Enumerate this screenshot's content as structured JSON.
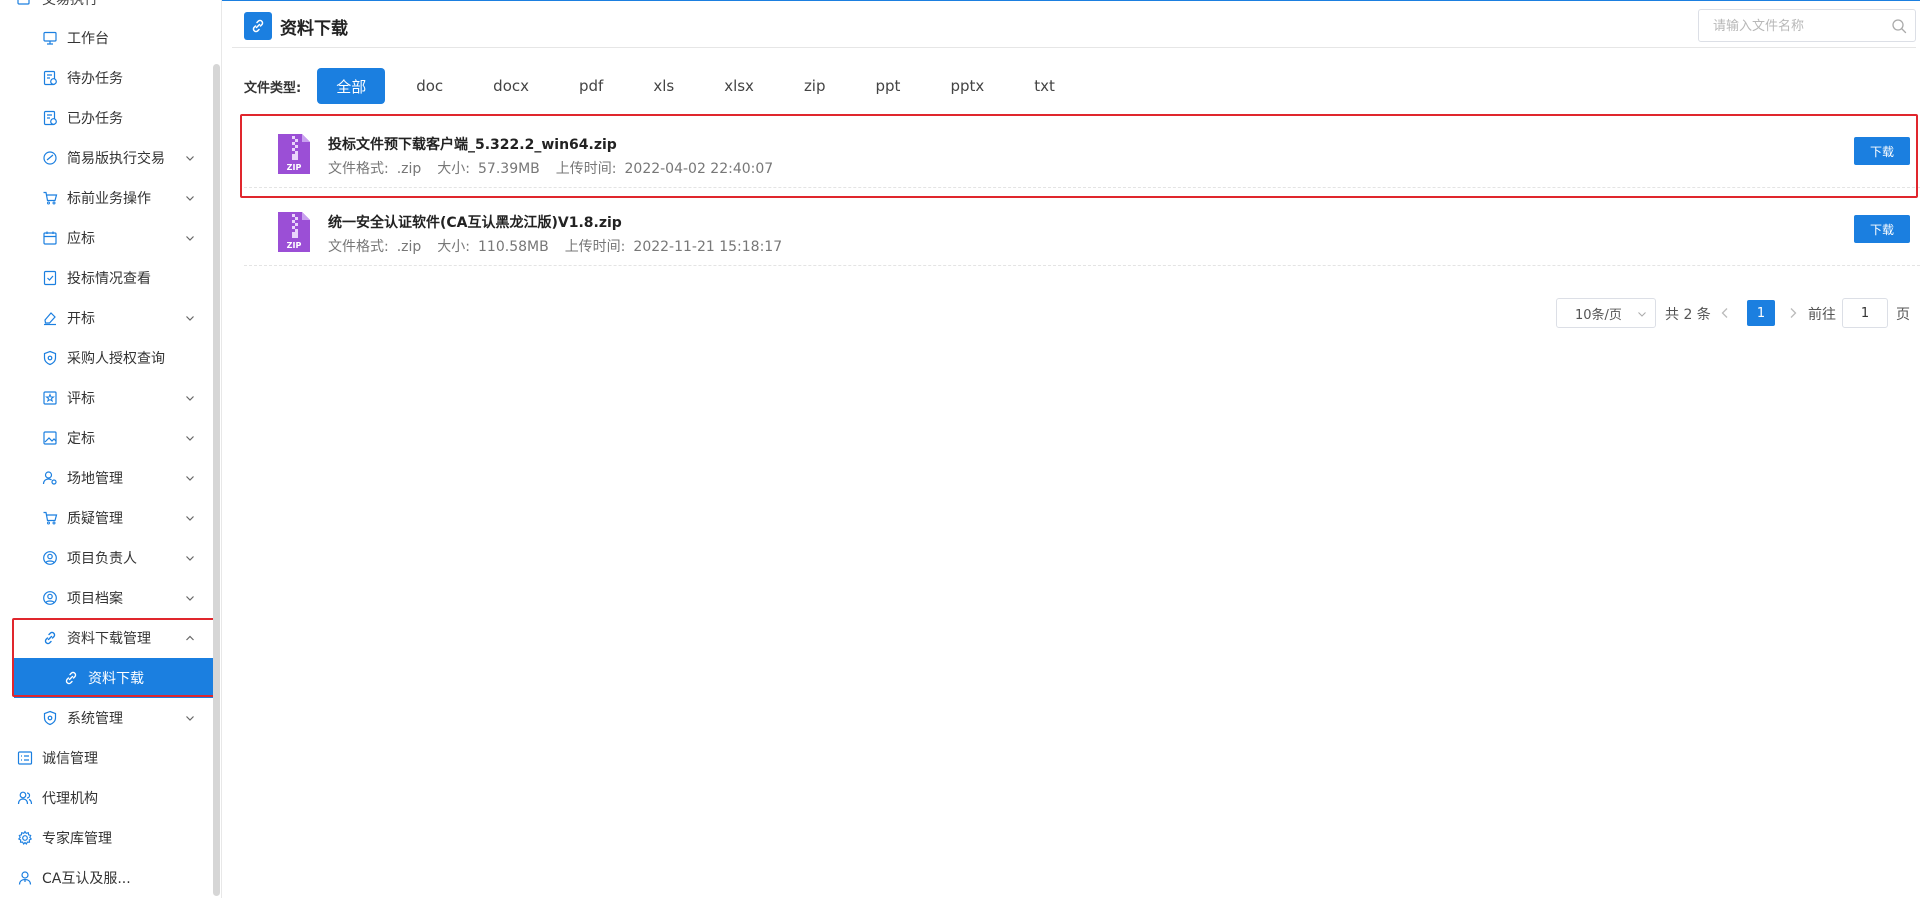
{
  "sidebar": {
    "top_partial_label": "交易执行",
    "items": [
      {
        "label": "工作台",
        "icon": "monitor-icon",
        "expandable": false
      },
      {
        "label": "待办任务",
        "icon": "todo-doc-icon",
        "expandable": false
      },
      {
        "label": "已办任务",
        "icon": "done-doc-icon",
        "expandable": false
      },
      {
        "label": "简易版执行交易",
        "icon": "fast-trade-icon",
        "expandable": true
      },
      {
        "label": "标前业务操作",
        "icon": "cart-icon",
        "expandable": true
      },
      {
        "label": "应标",
        "icon": "calendar-icon",
        "expandable": true
      },
      {
        "label": "投标情况查看",
        "icon": "check-doc-icon",
        "expandable": false
      },
      {
        "label": "开标",
        "icon": "eraser-icon",
        "expandable": true
      },
      {
        "label": "采购人授权查询",
        "icon": "shield-icon",
        "expandable": false
      },
      {
        "label": "评标",
        "icon": "star-box-icon",
        "expandable": true
      },
      {
        "label": "定标",
        "icon": "image-icon",
        "expandable": true
      },
      {
        "label": "场地管理",
        "icon": "user-gear-icon",
        "expandable": true
      },
      {
        "label": "质疑管理",
        "icon": "cart-icon",
        "expandable": true
      },
      {
        "label": "项目负责人",
        "icon": "user-circle-icon",
        "expandable": true
      },
      {
        "label": "项目档案",
        "icon": "user-circle-icon",
        "expandable": true
      },
      {
        "label": "资料下载管理",
        "icon": "link-icon",
        "expandable": true,
        "expanded": true
      },
      {
        "label": "资料下载",
        "icon": "link-icon",
        "expandable": false,
        "active": true
      },
      {
        "label": "系统管理",
        "icon": "shield-icon",
        "expandable": true
      }
    ],
    "top_level": [
      {
        "label": "诚信管理",
        "icon": "list-icon"
      },
      {
        "label": "代理机构",
        "icon": "user-group-icon"
      },
      {
        "label": "专家库管理",
        "icon": "gear-icon"
      },
      {
        "label": "CA互认及服...",
        "icon": "agent-icon"
      }
    ]
  },
  "header": {
    "title": "资料下载",
    "icon": "link-icon",
    "search_placeholder": "请输入文件名称"
  },
  "filter": {
    "label": "文件类型:",
    "options": [
      "全部",
      "doc",
      "docx",
      "pdf",
      "xls",
      "xlsx",
      "zip",
      "ppt",
      "pptx",
      "txt"
    ],
    "selected": "全部"
  },
  "files": [
    {
      "name": "投标文件预下载客户端_5.322.2_win64.zip",
      "format_label": "文件格式:",
      "format": ".zip",
      "size_label": "大小:",
      "size": "57.39MB",
      "time_label": "上传时间:",
      "time": "2022-04-02 22:40:07",
      "download_label": "下载",
      "icon_text": "ZIP"
    },
    {
      "name": "统一安全认证软件(CA互认黑龙江版)V1.8.zip",
      "format_label": "文件格式:",
      "format": ".zip",
      "size_label": "大小:",
      "size": "110.58MB",
      "time_label": "上传时间:",
      "time": "2022-11-21 15:18:17",
      "download_label": "下载",
      "icon_text": "ZIP"
    }
  ],
  "pagination": {
    "page_size": "10条/页",
    "total": "共 2 条",
    "current_page": "1",
    "goto_label": "前往",
    "goto_value": "1",
    "page_unit": "页"
  },
  "colors": {
    "primary": "#1b7fe0",
    "highlight": "#e0262d",
    "zip_icon": "#9b4fd6"
  }
}
